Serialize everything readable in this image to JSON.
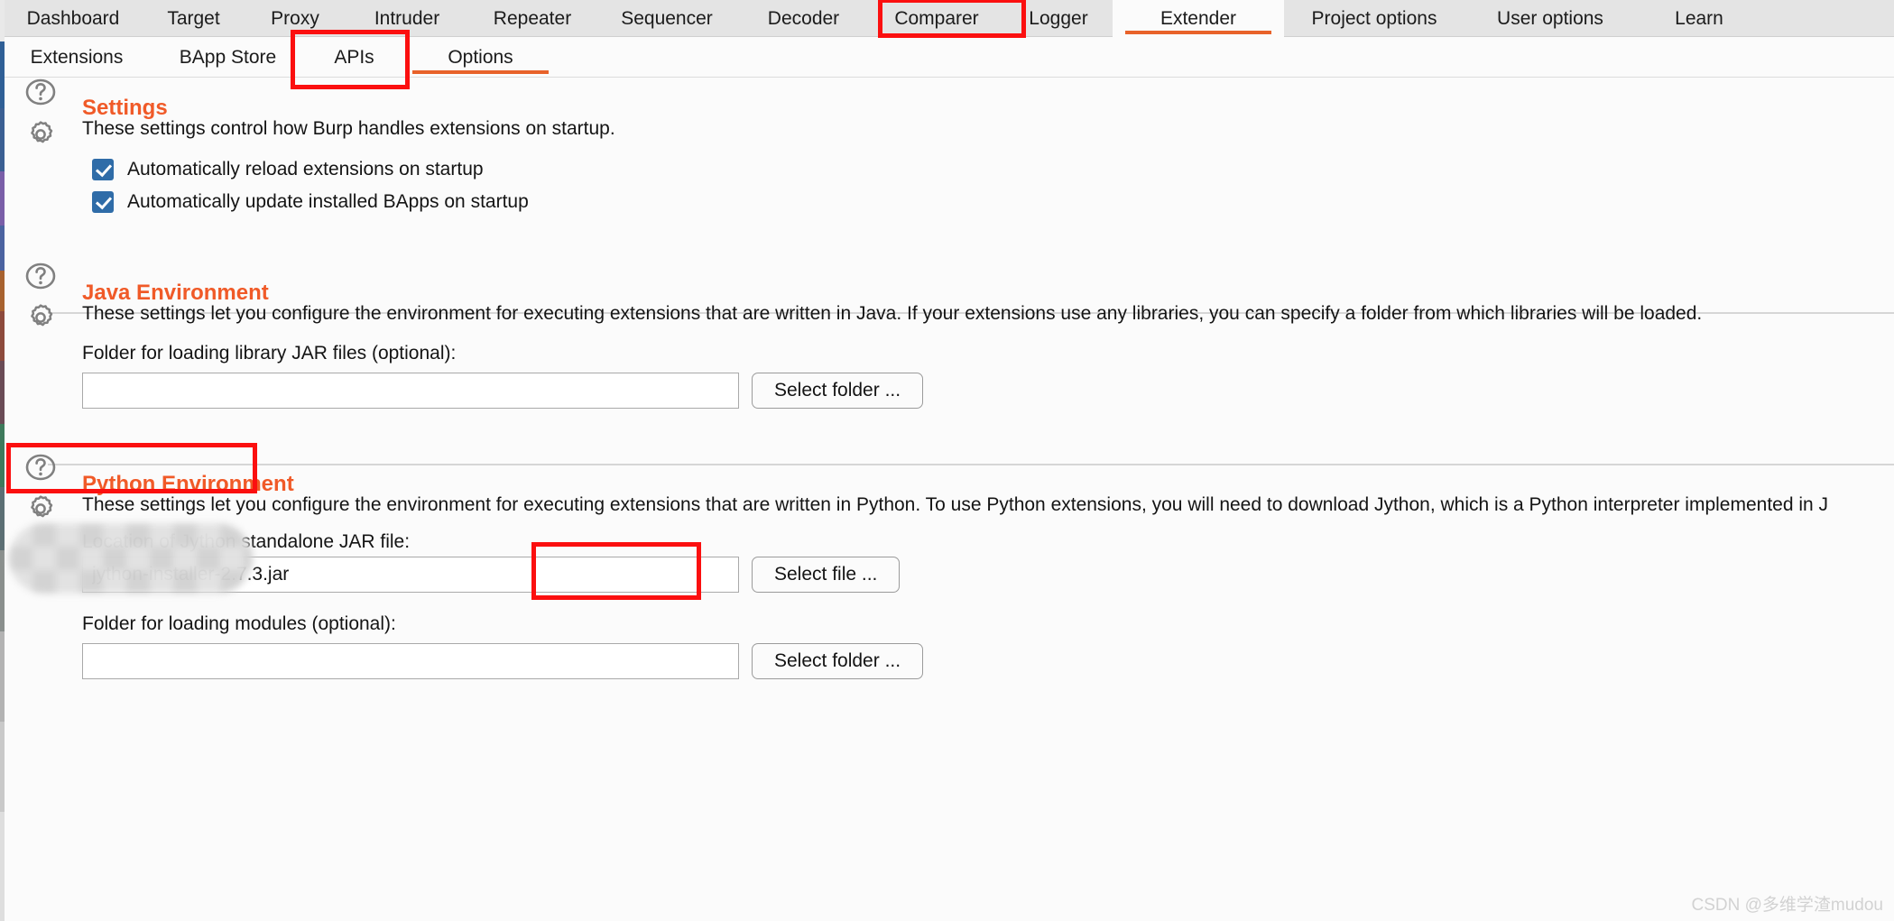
{
  "app": {
    "name": "Burp Suite Extender Options",
    "accent_color": "#f05a28",
    "annotation_color": "#fb0f0f",
    "checkbox_color": "#2f6ca8"
  },
  "main_tabs": [
    {
      "label": "Dashboard",
      "active": false
    },
    {
      "label": "Target",
      "active": false
    },
    {
      "label": "Proxy",
      "active": false
    },
    {
      "label": "Intruder",
      "active": false
    },
    {
      "label": "Repeater",
      "active": false
    },
    {
      "label": "Sequencer",
      "active": false
    },
    {
      "label": "Decoder",
      "active": false
    },
    {
      "label": "Comparer",
      "active": false
    },
    {
      "label": "Logger",
      "active": false
    },
    {
      "label": "Extender",
      "active": true
    },
    {
      "label": "Project options",
      "active": false
    },
    {
      "label": "User options",
      "active": false
    },
    {
      "label": "Learn",
      "active": false
    }
  ],
  "sub_tabs": [
    {
      "label": "Extensions",
      "active": false
    },
    {
      "label": "BApp Store",
      "active": false
    },
    {
      "label": "APIs",
      "active": false
    },
    {
      "label": "Options",
      "active": true
    }
  ],
  "sections": {
    "settings": {
      "title": "Settings",
      "description": "These settings control how Burp handles extensions on startup.",
      "help_icon": "question-mark-circle-icon",
      "gear_icon": "gear-icon",
      "checkboxes": [
        {
          "label": "Automatically reload extensions on startup",
          "checked": true
        },
        {
          "label": "Automatically update installed BApps on startup",
          "checked": true
        }
      ]
    },
    "java_environment": {
      "title": "Java Environment",
      "description": "These settings let you configure the environment for executing extensions that are written in Java. If your extensions use any libraries, you can specify a folder from which libraries will be loaded.",
      "help_icon": "question-mark-circle-icon",
      "gear_icon": "gear-icon",
      "folder_field": {
        "label": "Folder for loading library JAR files (optional):",
        "value": "",
        "placeholder": "",
        "button_label": "Select folder ..."
      }
    },
    "python_environment": {
      "title": "Python Environment",
      "description": "These settings let you configure the environment for executing extensions that are written in Python. To use Python extensions, you will need to download Jython, which is a Python interpreter implemented in J",
      "help_icon": "question-mark-circle-icon",
      "gear_icon": "gear-icon",
      "jar_field": {
        "label": "Location of Jython standalone JAR file:",
        "label_visible_prefix": "Lo",
        "label_visible_suffix": "e JAR file:",
        "value": "jython-installer-2.7.3.jar",
        "value_redacted": true,
        "button_label": "Select file ..."
      },
      "modules_field": {
        "label": "Folder for loading modules (optional):",
        "value": "",
        "placeholder": "",
        "button_label": "Select folder ..."
      }
    }
  },
  "watermark": "CSDN @多维学渣mudou"
}
